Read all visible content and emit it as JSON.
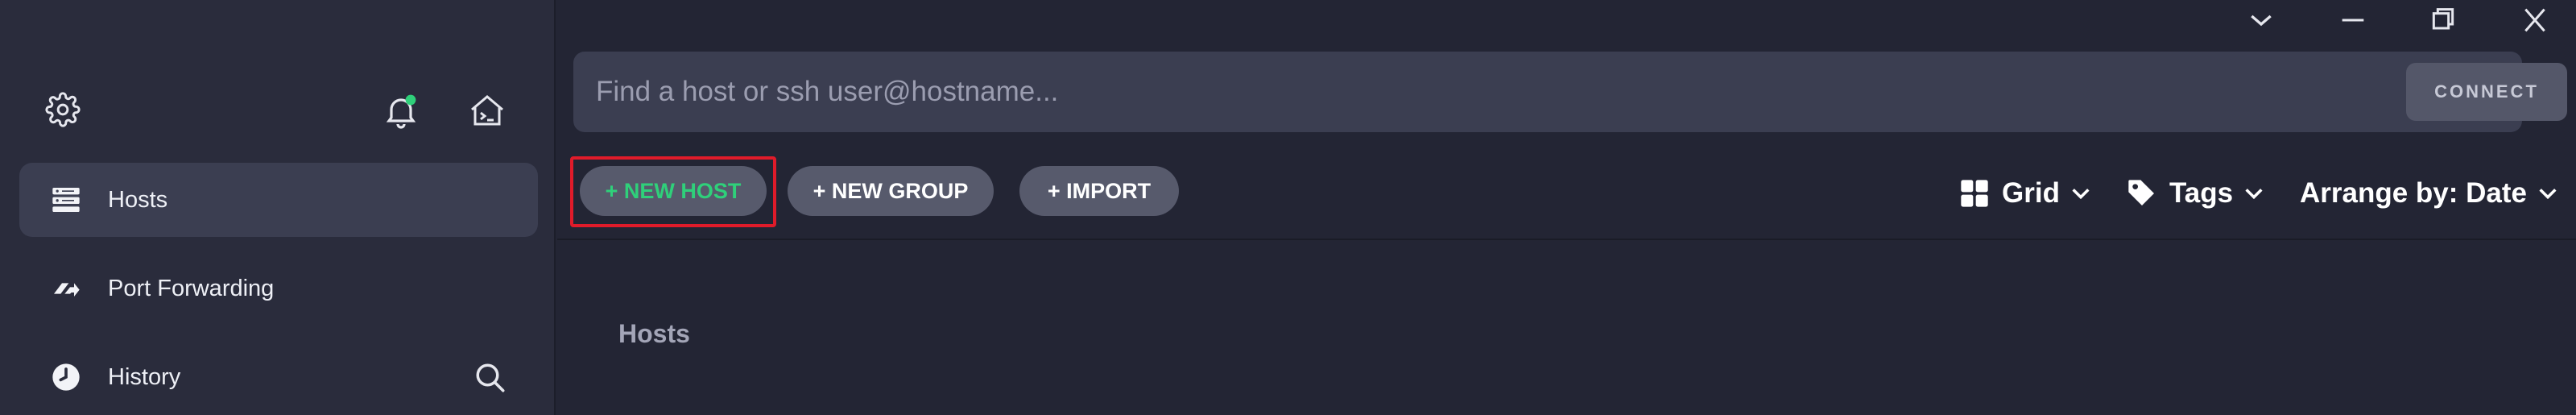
{
  "sidebar": {
    "icons": {
      "settings": "gear-icon",
      "notifications": "bell-icon",
      "local_terminal": "terminal-home-icon",
      "search": "search-icon"
    },
    "notification_dot_color": "#2fd07a",
    "items": [
      {
        "label": "Hosts",
        "icon": "hosts-icon",
        "active": true
      },
      {
        "label": "Port Forwarding",
        "icon": "port-forwarding-icon",
        "active": false
      },
      {
        "label": "History",
        "icon": "history-icon",
        "active": false
      }
    ]
  },
  "window_controls": [
    "chevron-down-icon",
    "minimize-icon",
    "restore-icon",
    "close-icon"
  ],
  "search": {
    "placeholder": "Find a host or ssh user@hostname...",
    "value": "",
    "connect_label": "CONNECT"
  },
  "toolbar": {
    "new_host_label": "+ NEW HOST",
    "new_group_label": "+ NEW GROUP",
    "import_label": "+ IMPORT",
    "view_label": "Grid",
    "tags_label": "Tags",
    "arrange_label": "Arrange by: Date"
  },
  "main": {
    "section_title": "Hosts"
  },
  "colors": {
    "accent": "#2fd07a",
    "highlight": "#e01b2a",
    "background": "#232534",
    "sidebar": "#2a2c3c"
  }
}
